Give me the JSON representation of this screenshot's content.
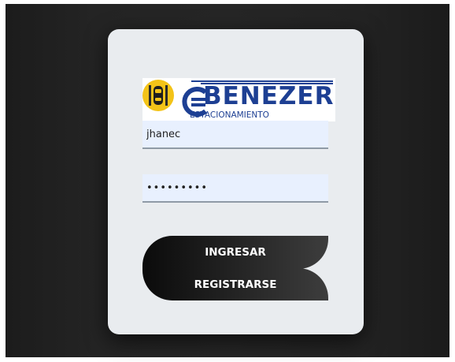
{
  "logo": {
    "brand": "BENEZER",
    "subtitle": "ESTACIONAMIENTO",
    "badge_icon": "car-parking-icon"
  },
  "form": {
    "username_value": "jhanec",
    "password_value": "•••••••••"
  },
  "buttons": {
    "login_label": "INGRESAR",
    "register_label": "REGISTRARSE"
  },
  "colors": {
    "brand_blue": "#1d3f93",
    "badge_yellow": "#f3c318",
    "card_bg": "#e9ecef",
    "input_bg": "#e8f0fe",
    "button_dark": "#1a1a1a"
  }
}
